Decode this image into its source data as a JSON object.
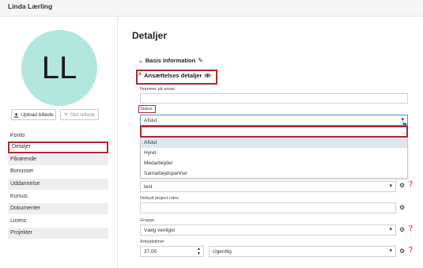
{
  "header": {
    "username": "Linda Lærling"
  },
  "profile": {
    "initials": "LL",
    "upload_label": "Upload billede",
    "delete_label": "Slet billede"
  },
  "sidebar": {
    "items": [
      {
        "label": "Konto"
      },
      {
        "label": "Detaljer"
      },
      {
        "label": "Pårørende"
      },
      {
        "label": "Bonusser"
      },
      {
        "label": "Uddannelse"
      },
      {
        "label": "Kursus"
      },
      {
        "label": "Dokumenter"
      },
      {
        "label": "Licens"
      },
      {
        "label": "Projekter"
      }
    ]
  },
  "main": {
    "title": "Detaljer",
    "sections": {
      "basis": "Basis information",
      "ansaettelse": "Ansættelses detaljer"
    },
    "fields": {
      "nummer_label": "Nummer på ansat",
      "status_label": "Status",
      "status_value": "Afslut",
      "status_options": [
        "Afslut",
        "Hyret",
        "Medarbejder",
        "Samarbejdspartner"
      ],
      "role_value": "test",
      "default_roles_label": "Default project roles",
      "gruppe_label": "Gruppe",
      "gruppe_placeholder": "Vælg venligst",
      "arbejdstimer_label": "Arbejdstimer",
      "arbejdstimer_value": "37,00",
      "periode_value": "Ugentlig"
    }
  },
  "colors": {
    "avatar_bg": "#b1e7dd",
    "highlight_border": "#b0272c",
    "focus_border": "#5b8fd0",
    "option_selected_bg": "#dfe6ee"
  }
}
